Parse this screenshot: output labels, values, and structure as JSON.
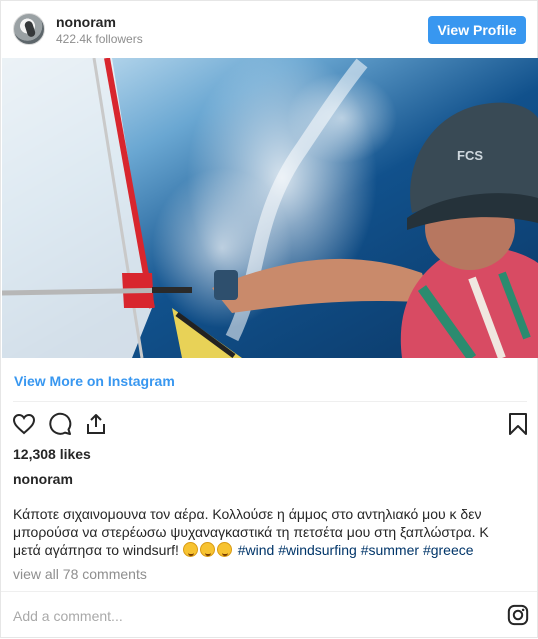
{
  "header": {
    "username": "nonoram",
    "followers": "422.4k followers",
    "view_profile_label": "View Profile"
  },
  "post": {
    "view_more_label": "View More on Instagram",
    "likes": "12,308 likes",
    "owner": "nonoram",
    "caption_text": "Κάποτε σιχαινομουνα τον αέρα. Κολλούσε η άμμος στο αντηλιακό μου κ δεν μπορούσα να στερέωσω ψυχαναγκαστικά τη πετσέτα μου στη ξαπλώστρα. Κ μετά αγάπησα το windsurf!",
    "hashtags": [
      "#wind",
      "#windsurfing",
      "#summer",
      "#greece"
    ],
    "view_comments_label": "view all 78 comments"
  },
  "comment_box": {
    "placeholder": "Add a comment..."
  },
  "icons": {
    "like": "heart-icon",
    "comment": "comment-icon",
    "share": "share-icon",
    "save": "bookmark-icon",
    "instagram": "instagram-logo-icon"
  },
  "colors": {
    "accent": "#3897f0",
    "hashtag": "#003569",
    "muted": "#8e8e8e",
    "text": "#262626"
  }
}
